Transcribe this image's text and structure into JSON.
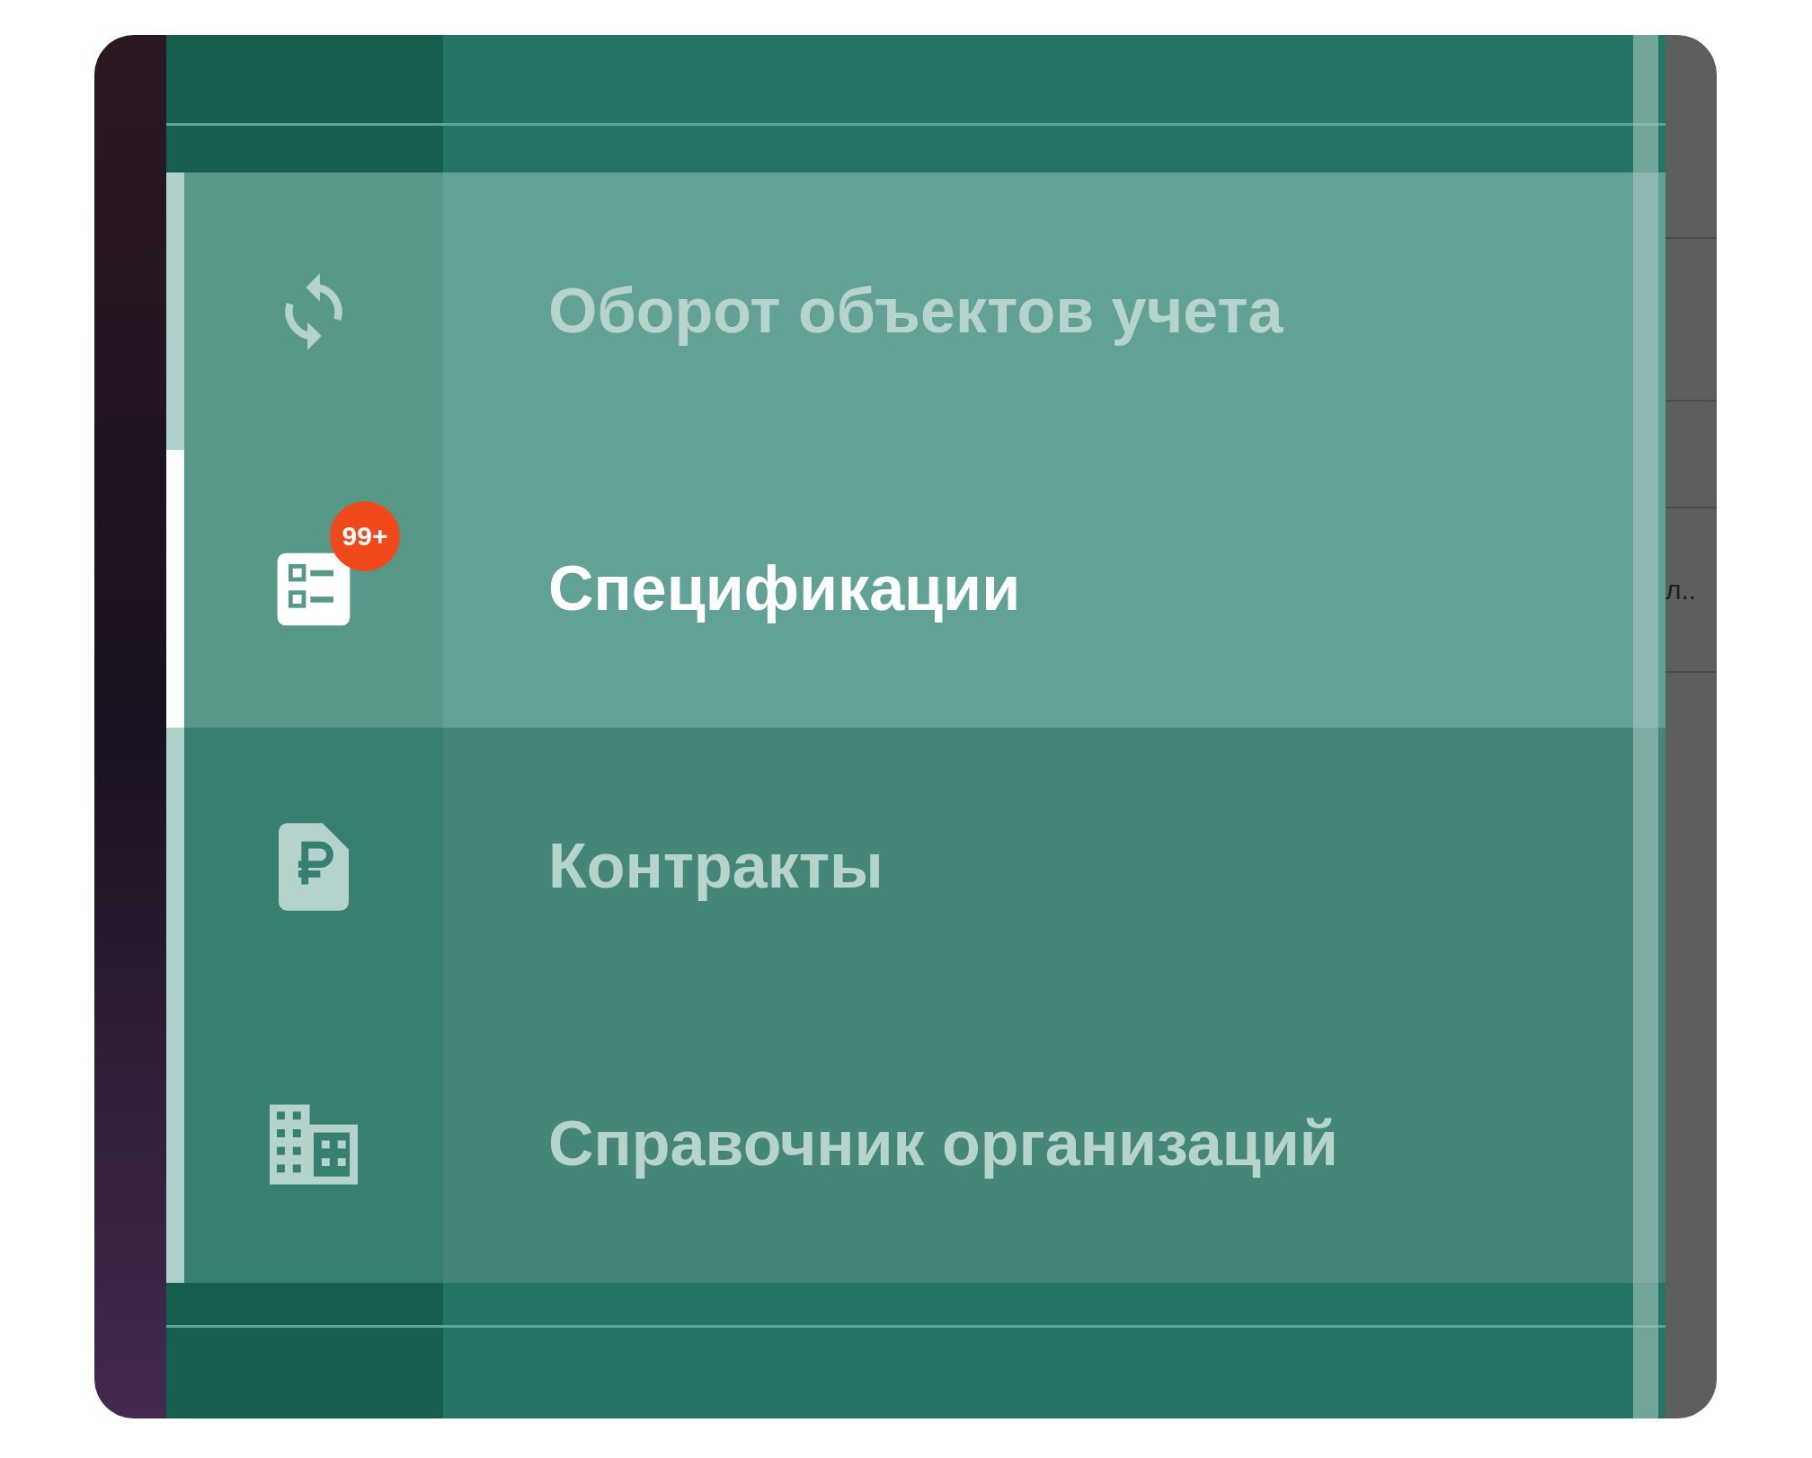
{
  "menu": {
    "items": [
      {
        "kind": "sync",
        "label": "Оборот объектов учета",
        "selected": false,
        "hovered": true
      },
      {
        "kind": "list",
        "label": "Спецификации",
        "selected": true,
        "hovered": false,
        "badge": "99+"
      },
      {
        "kind": "contract",
        "label": "Контракты",
        "selected": false,
        "hovered": false
      },
      {
        "kind": "building",
        "label": "Справочник организаций",
        "selected": false,
        "hovered": false
      }
    ]
  },
  "background_cell": "л.."
}
